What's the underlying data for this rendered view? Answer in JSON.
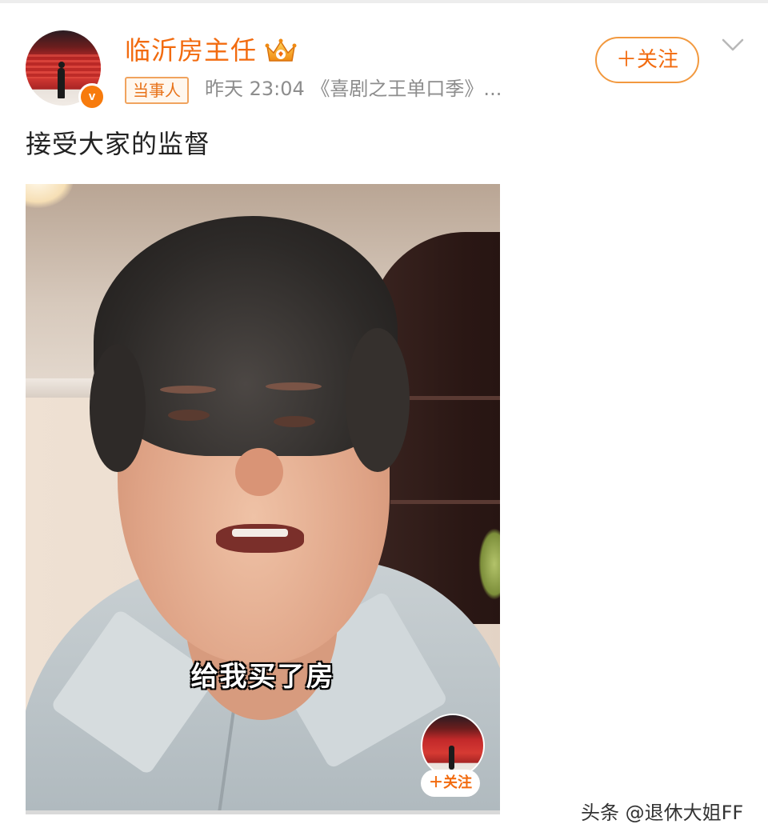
{
  "post": {
    "username": "临沂房主任",
    "tag": "当事人",
    "time": "昨天 23:04",
    "source": "《喜剧之王单口季》...",
    "follow_label": "＋关注",
    "content": "接受大家的监督"
  },
  "video": {
    "subtitle": "给我买了房",
    "mini_follow_label": "＋关注",
    "progress": 0.0
  },
  "watermark": "头条 @退休大姐FF",
  "colors": {
    "accent": "#f26b0f",
    "tag_border": "#f0a35e",
    "meta_text": "#8d8d8d"
  },
  "icons": {
    "verified": "verified-v-icon",
    "crown": "crown-icon",
    "more": "chevron-down-icon"
  }
}
